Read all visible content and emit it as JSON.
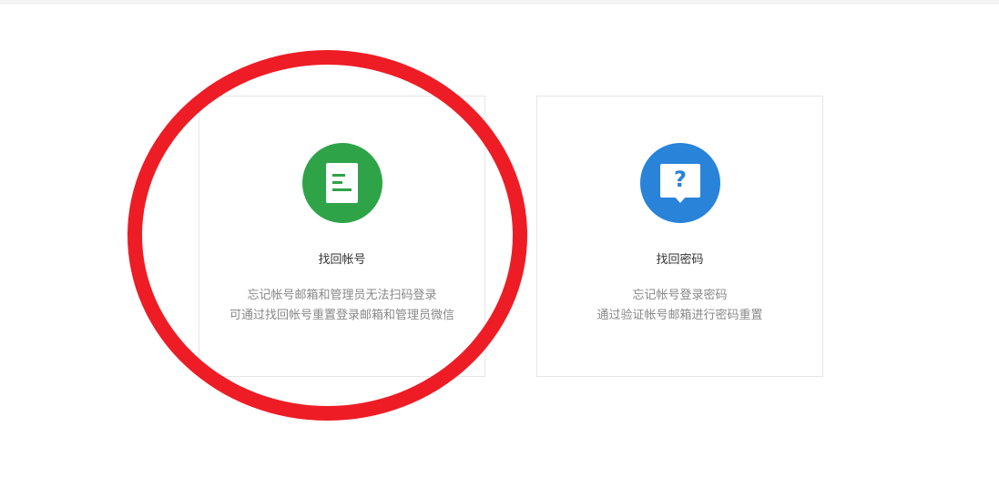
{
  "cards": [
    {
      "title": "找回帐号",
      "desc_line1": "忘记帐号邮箱和管理员无法扫码登录",
      "desc_line2": "可通过找回帐号重置登录邮箱和管理员微信",
      "icon": "document-icon",
      "icon_color": "#2ea348"
    },
    {
      "title": "找回密码",
      "desc_line1": "忘记帐号登录密码",
      "desc_line2": "通过验证帐号邮箱进行密码重置",
      "icon": "question-bubble-icon",
      "icon_color": "#2883d9",
      "icon_glyph": "?"
    }
  ],
  "annotation": {
    "color": "#ee1c25"
  }
}
